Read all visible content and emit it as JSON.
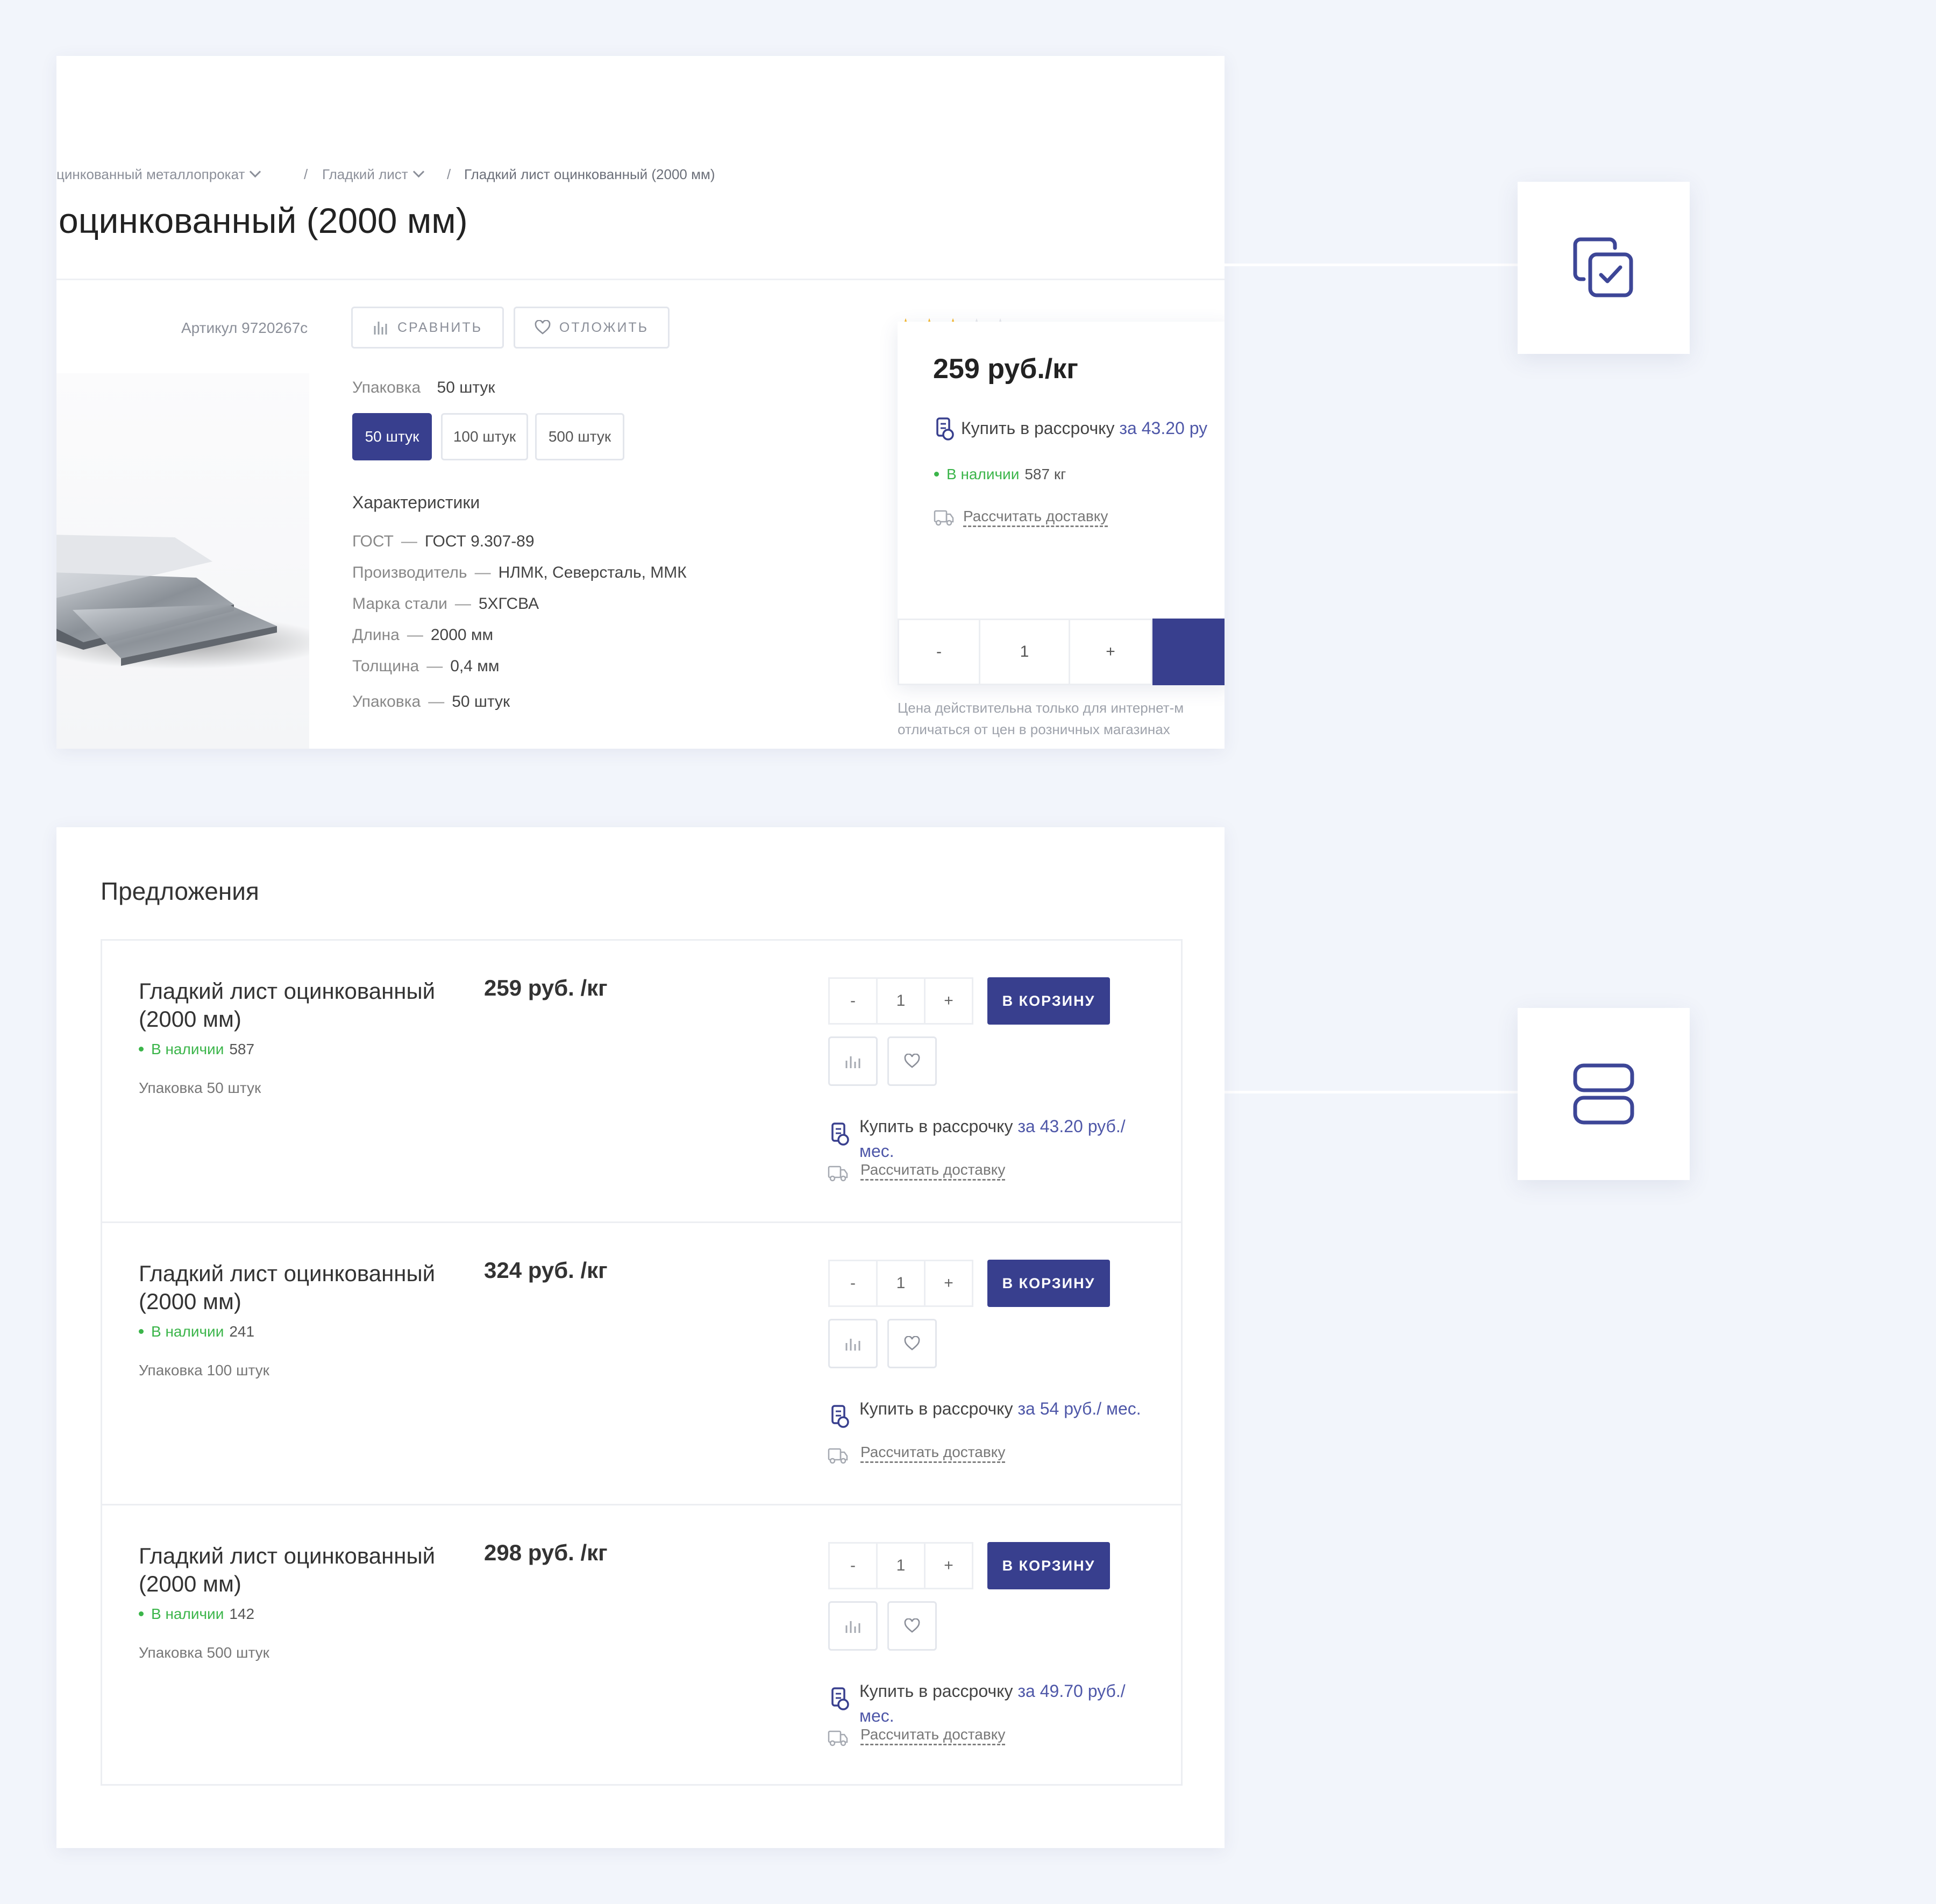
{
  "breadcrumb": {
    "item1": "цинкованный металлопрокат",
    "item2": "Гладкий лист",
    "item3": "Гладкий лист оцинкованный (2000 мм)",
    "sep": "/"
  },
  "product": {
    "title": "оцинкованный (2000 мм)",
    "article": "Артикул 9720267c",
    "compare_label": "СРАВНИТЬ",
    "wishlist_label": "ОТЛОЖИТЬ",
    "rating": 3,
    "rating_max": 5,
    "packing_label": "Упаковка",
    "packing_value": "50 штук",
    "packing_options": [
      "50 штук",
      "100 штук",
      "500 штук"
    ],
    "specs_title": "Характеристики",
    "specs": [
      {
        "k": "ГОСТ",
        "v": "ГОСТ 9.307-89"
      },
      {
        "k": "Производитель",
        "v": "НЛМК, Северсталь, ММК"
      },
      {
        "k": "Марка стали",
        "v": "5ХГСВА"
      },
      {
        "k": "Длина",
        "v": "2000 мм"
      },
      {
        "k": "Толщина",
        "v": "0,4 мм"
      },
      {
        "k": "Упаковка",
        "v": "50 штук"
      }
    ],
    "dash": "—"
  },
  "buybox": {
    "price": "259 руб./кг",
    "installment_text": "Купить в рассрочку",
    "installment_amount": "за 43.20 ру",
    "stock_label": "В наличии",
    "stock_value": "587 кг",
    "delivery": "Рассчитать доставку",
    "qty_minus": "-",
    "qty": "1",
    "qty_plus": "+",
    "note_line1": "Цена действительна только для интернет-м",
    "note_line2": "отличаться от цен в розничных магазинах"
  },
  "offers": {
    "title": "Предложения",
    "cart_label": "В КОРЗИНУ",
    "delivery": "Рассчитать доставку",
    "installment_text": "Купить в рассрочку",
    "stock_label": "В наличии",
    "items": [
      {
        "name": "Гладкий лист оцинкованный (2000 мм)",
        "stock": "587",
        "pack": "Упаковка 50 штук",
        "price": "259 руб. /кг",
        "qty": "1",
        "inst_amount": "за 43.20",
        "inst_tail": "руб./ мес."
      },
      {
        "name": "Гладкий лист оцинкованный (2000 мм)",
        "stock": "241",
        "pack": "Упаковка 100 штук",
        "price": "324 руб. /кг",
        "qty": "1",
        "inst_amount": "за 54 руб./",
        "inst_tail": "мес."
      },
      {
        "name": "Гладкий лист оцинкованный (2000 мм)",
        "stock": "142",
        "pack": "Упаковка 500 штук",
        "price": "298 руб. /кг",
        "qty": "1",
        "inst_amount": "за 49.70",
        "inst_tail": "руб./ мес."
      }
    ]
  },
  "icons": {
    "side_top": "copy-check-icon",
    "side_bottom": "rows-layout-icon"
  },
  "colors": {
    "accent": "#383f8e",
    "link": "#4e57a8",
    "stock": "#3bb54a",
    "star": "#f5b72a",
    "background": "#f2f5fb"
  }
}
